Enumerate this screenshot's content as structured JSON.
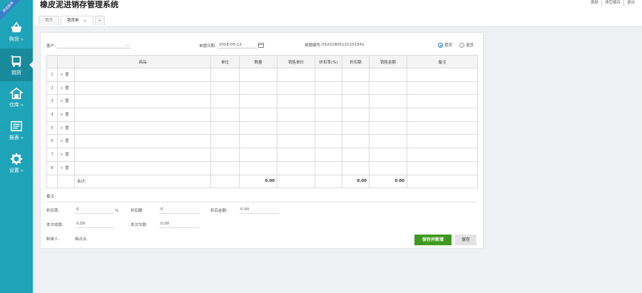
{
  "ribbon": "测试版本",
  "sidebar": {
    "items": [
      {
        "label": "购货",
        "icon": "basket-icon"
      },
      {
        "label": "销货",
        "icon": "cart-icon"
      },
      {
        "label": "仓库",
        "icon": "house-icon"
      },
      {
        "label": "报表",
        "icon": "report-icon"
      },
      {
        "label": "设置",
        "icon": "gear-icon"
      }
    ],
    "active_index": 1
  },
  "header": {
    "title": "橡皮泥进销存管理系统",
    "links": [
      "换肤",
      "清空缓存",
      "退出"
    ],
    "tabs": [
      "首页",
      "销货单",
      "+"
    ]
  },
  "form": {
    "customer_label": "客户:",
    "customer_more": "...",
    "date_label": "单据日期:",
    "date_value": "2018-05-12",
    "number_label": "单据编号:",
    "number_value": "XS201805121101341",
    "radio_sale": "销货",
    "radio_return": "退货",
    "selected_radio": "销货"
  },
  "table": {
    "headers": [
      "",
      "",
      "商品",
      "单位",
      "数量",
      "销售单价",
      "折扣率(%)",
      "折扣额",
      "销售金额",
      "备注"
    ],
    "rows": [
      "1",
      "2",
      "3",
      "4",
      "5",
      "6",
      "7",
      "8"
    ],
    "row_ops": "+ 🗑",
    "total_label": "合计:",
    "totals": {
      "quantity": "0.00",
      "discount": "0.00",
      "amount": "0.00"
    }
  },
  "footer": {
    "remark_label": "备注:",
    "discount_rate_label": "折扣率:",
    "discount_rate_value": "0",
    "percent": "%",
    "discount_amount_label": "折扣额:",
    "discount_amount_value": "0",
    "after_discount_label": "折后金额:",
    "after_discount_value": "0.00",
    "received_label": "本次收款:",
    "received_value": "0.00",
    "due_label": "本次欠款:",
    "due_value": "0.00",
    "maker_label": "制单人:",
    "maker_value": "麻点点",
    "save_new": "保存并新增",
    "save": "保存"
  },
  "colors": {
    "sidebar": "#1fa3b8",
    "primary_button": "#3f9a1f"
  }
}
